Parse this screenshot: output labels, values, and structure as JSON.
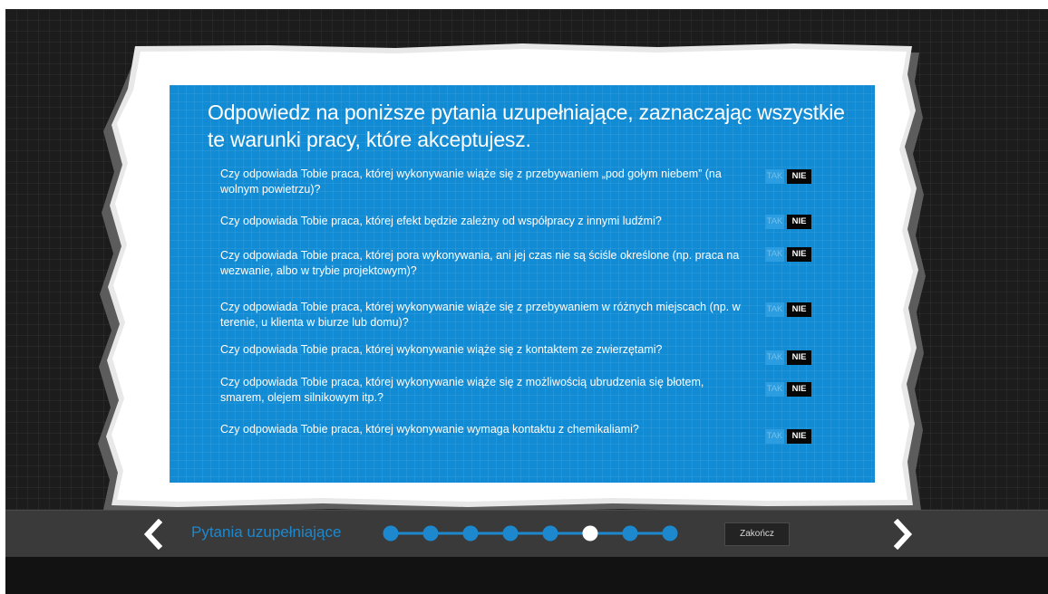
{
  "heading": "Odpowiedz na poniższe pytania uzupełniające, zaznaczając wszystkie te warunki pracy, które akceptujesz.",
  "questions": [
    {
      "text": "Czy odpowiada Tobie praca, której wykonywanie wiąże się z przebywaniem „pod gołym niebem” (na wolnym powietrzu)?",
      "yes_label": "TAK",
      "no_label": "NIE",
      "selected": "NIE"
    },
    {
      "text": "Czy odpowiada Tobie praca, której efekt będzie zależny od współpracy z innymi ludźmi?",
      "yes_label": "TAK",
      "no_label": "NIE",
      "selected": "NIE"
    },
    {
      "text": "Czy odpowiada Tobie praca, której pora wykonywania, ani jej czas nie są ściśle określone (np. praca na wezwanie, albo w trybie projektowym)?",
      "yes_label": "TAK",
      "no_label": "NIE",
      "selected": "NIE"
    },
    {
      "text": "Czy odpowiada Tobie praca, której wykonywanie wiąże się z przebywaniem w różnych miejscach (np. w terenie, u klienta w biurze lub domu)?",
      "yes_label": "TAK",
      "no_label": "NIE",
      "selected": "NIE"
    },
    {
      "text": "Czy odpowiada Tobie praca, której wykonywanie wiąże się z kontaktem ze zwierzętami?",
      "yes_label": "TAK",
      "no_label": "NIE",
      "selected": "NIE"
    },
    {
      "text": "Czy odpowiada Tobie praca, której wykonywanie wiąże się z możliwością ubrudzenia się błotem, smarem, olejem silnikowym itp.?",
      "yes_label": "TAK",
      "no_label": "NIE",
      "selected": "NIE"
    },
    {
      "text": "Czy odpowiada Tobie praca, której wykonywanie wymaga kontaktu z chemikaliami?",
      "yes_label": "TAK",
      "no_label": "NIE",
      "selected": "NIE"
    }
  ],
  "footer": {
    "section_label": "Pytania uzupełniające",
    "finish_label": "Zakończ",
    "progress_steps": 8,
    "progress_current": 6,
    "prev_icon": "chevron-left-icon",
    "next_icon": "chevron-right-icon"
  },
  "colors": {
    "panel": "#118bd4",
    "accent": "#1e88ce",
    "background": "#1c1c1c"
  }
}
